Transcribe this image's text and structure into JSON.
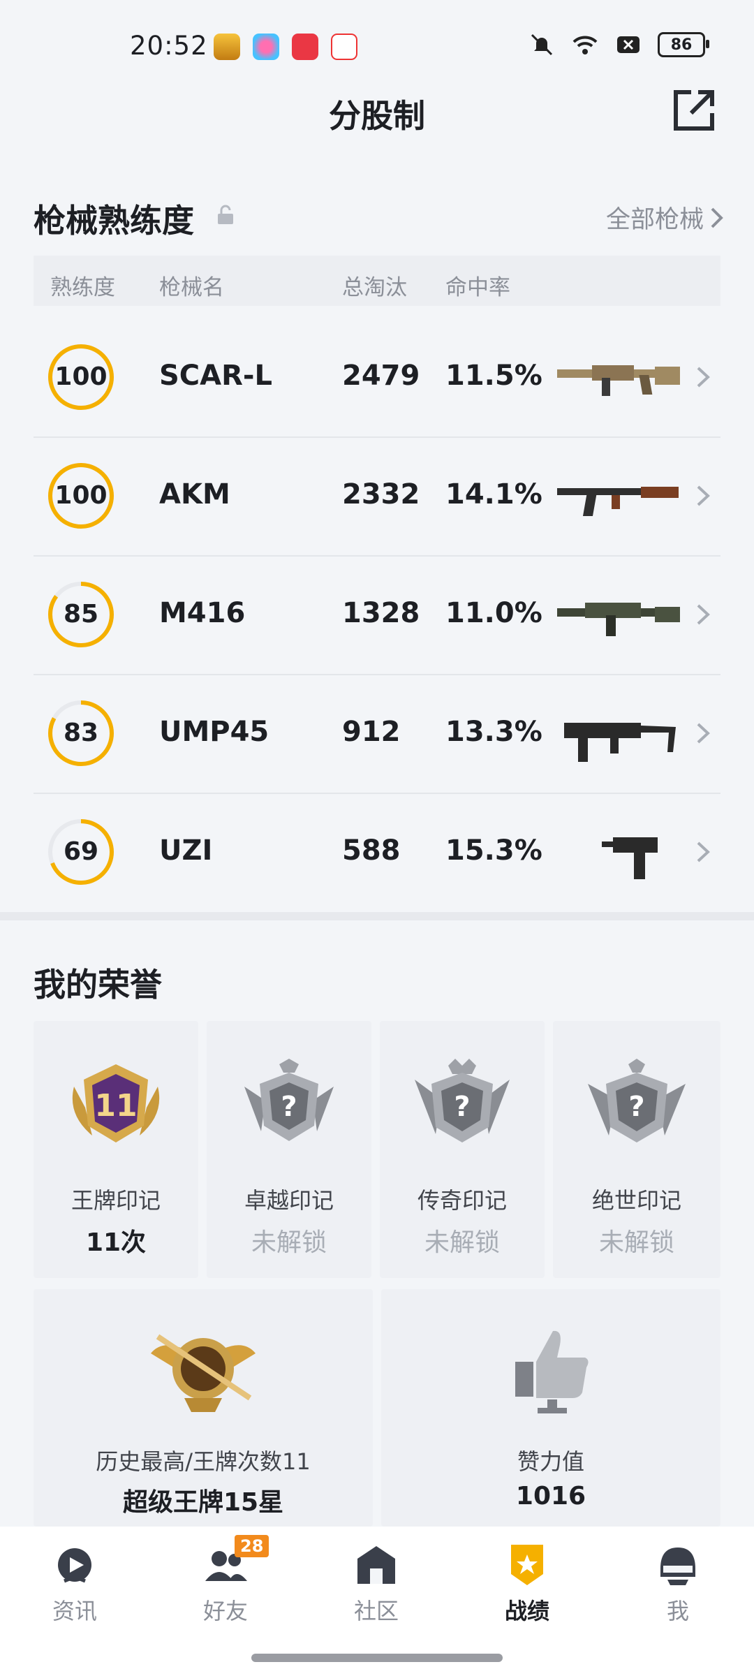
{
  "status_bar": {
    "time": "20:52",
    "battery": "86"
  },
  "header": {
    "title": "分股制"
  },
  "weapons": {
    "title": "枪械熟练度",
    "all_link": "全部枪械",
    "columns": [
      "熟练度",
      "枪械名",
      "总淘汰",
      "命中率"
    ],
    "rows": [
      {
        "proficiency": 100,
        "name": "SCAR-L",
        "kills": "2479",
        "hit_rate": "11.5%"
      },
      {
        "proficiency": 100,
        "name": "AKM",
        "kills": "2332",
        "hit_rate": "14.1%"
      },
      {
        "proficiency": 85,
        "name": "M416",
        "kills": "1328",
        "hit_rate": "11.0%"
      },
      {
        "proficiency": 83,
        "name": "UMP45",
        "kills": "912",
        "hit_rate": "13.3%"
      },
      {
        "proficiency": 69,
        "name": "UZI",
        "kills": "588",
        "hit_rate": "15.3%"
      }
    ]
  },
  "honors": {
    "title": "我的荣誉",
    "marks": [
      {
        "name": "王牌印记",
        "value": "11次",
        "badge_number": "11"
      },
      {
        "name": "卓越印记",
        "value": "未解锁"
      },
      {
        "name": "传奇印记",
        "value": "未解锁"
      },
      {
        "name": "绝世印记",
        "value": "未解锁"
      }
    ],
    "history": {
      "name": "历史最高/王牌次数11",
      "value": "超级王牌15星"
    },
    "likes": {
      "name": "赞力值",
      "value": "1016"
    }
  },
  "nav": {
    "items": [
      {
        "label": "资讯"
      },
      {
        "label": "好友",
        "badge": "28"
      },
      {
        "label": "社区"
      },
      {
        "label": "战绩"
      },
      {
        "label": "我"
      }
    ]
  },
  "colors": {
    "accent": "#f5b000",
    "ring_track": "#e7e9ed",
    "nav_badge": "#f28a1c"
  }
}
